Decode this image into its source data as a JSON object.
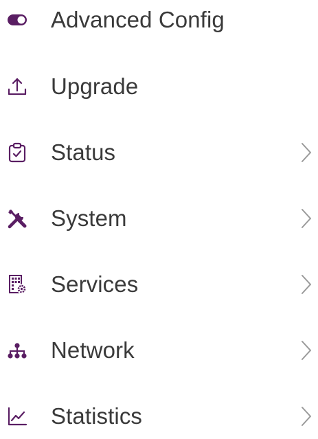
{
  "colors": {
    "accent": "#5a1e63",
    "text": "#3a3a3a",
    "chevron": "#9a9a9a"
  },
  "menu": {
    "items": [
      {
        "label": "Advanced Config",
        "icon": "toggle-icon",
        "has_submenu": false
      },
      {
        "label": "Upgrade",
        "icon": "upload-icon",
        "has_submenu": false
      },
      {
        "label": "Status",
        "icon": "clipboard-check-icon",
        "has_submenu": true
      },
      {
        "label": "System",
        "icon": "tools-icon",
        "has_submenu": true
      },
      {
        "label": "Services",
        "icon": "building-gear-icon",
        "has_submenu": true
      },
      {
        "label": "Network",
        "icon": "network-tree-icon",
        "has_submenu": true
      },
      {
        "label": "Statistics",
        "icon": "line-chart-icon",
        "has_submenu": true
      }
    ]
  }
}
